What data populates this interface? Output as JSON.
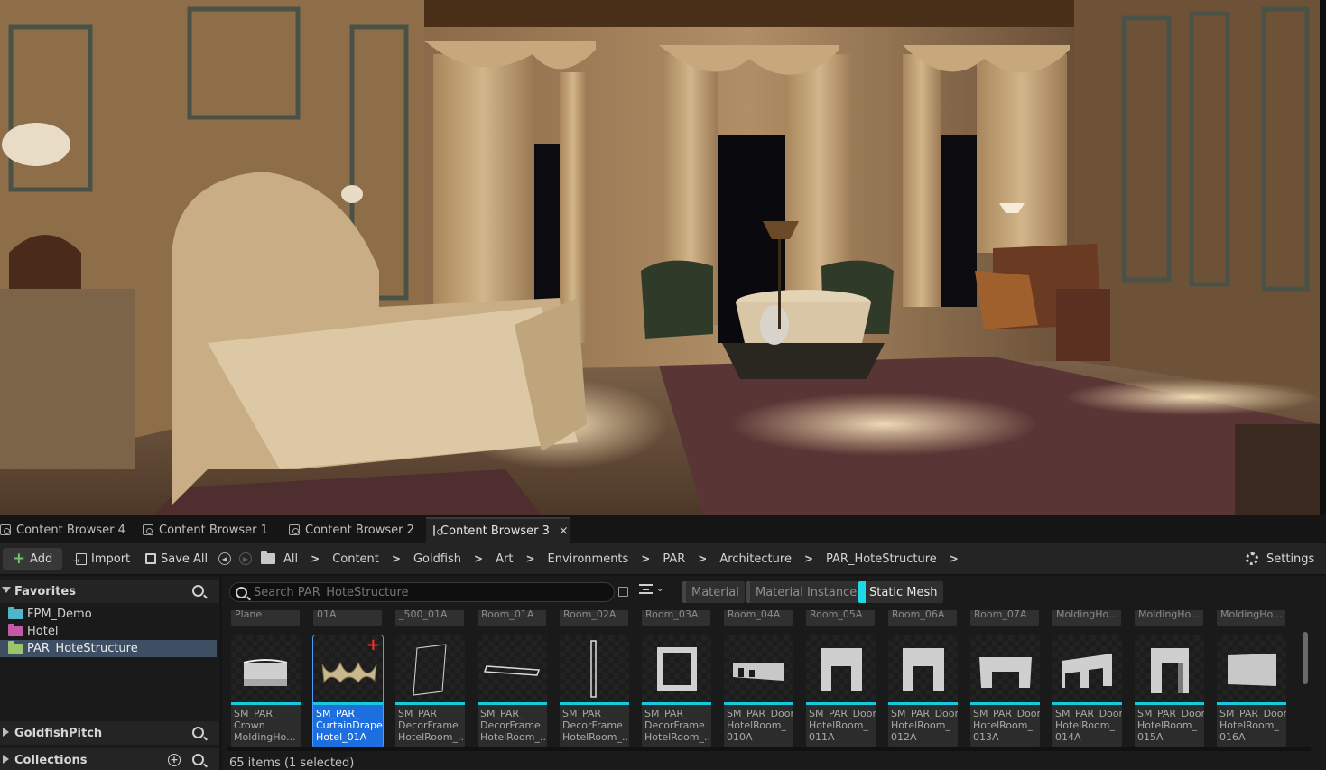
{
  "tabs": [
    {
      "label": "Content Browser 4",
      "active": false
    },
    {
      "label": "Content Browser 1",
      "active": false
    },
    {
      "label": "Content Browser 2",
      "active": false
    },
    {
      "label": "Content Browser 3",
      "active": true
    }
  ],
  "tab_close_glyph": "×",
  "toolbar": {
    "add_label": "Add",
    "import_label": "Import",
    "save_all_label": "Save All",
    "settings_label": "Settings"
  },
  "breadcrumb": [
    "All",
    "Content",
    "Goldfish",
    "Art",
    "Environments",
    "PAR",
    "Architecture",
    "PAR_HoteStructure"
  ],
  "favorites": {
    "header": "Favorites",
    "items": [
      {
        "label": "FPM_Demo",
        "color": "#4fb5c9"
      },
      {
        "label": "Hotel",
        "color": "#c25aa8"
      },
      {
        "label": "PAR_HoteStructure",
        "color": "#9cc46a",
        "selected": true
      }
    ]
  },
  "goldfishpitch_header": "GoldfishPitch",
  "collections_header": "Collections",
  "search": {
    "placeholder": "Search PAR_HoteStructure"
  },
  "filters": [
    {
      "label": "Material",
      "active": false
    },
    {
      "label": "Material Instance",
      "active": false
    },
    {
      "label": "Static Mesh",
      "active": true
    }
  ],
  "top_row_labels": [
    "Plane",
    "01A",
    "_500_01A",
    "Room_01A",
    "Room_02A",
    "Room_03A",
    "Room_04A",
    "Room_05A",
    "Room_06A",
    "Room_07A",
    "MoldingHo...",
    "MoldingHo...",
    "MoldingHo..."
  ],
  "assets": [
    {
      "label": "SM_PAR_\nCrown\nMoldingHo...",
      "shape": "crown"
    },
    {
      "label": "SM_PAR_\nCurtainDrape\nHotel_01A",
      "shape": "curtain",
      "selected": true
    },
    {
      "label": "SM_PAR_\nDecorFrame\nHotelRoom_...",
      "shape": "frame-thin"
    },
    {
      "label": "SM_PAR_\nDecorFrame\nHotelRoom_...",
      "shape": "frame-flat"
    },
    {
      "label": "SM_PAR_\nDecorFrame\nHotelRoom_...",
      "shape": "frame-tall"
    },
    {
      "label": "SM_PAR_\nDecorFrame\nHotelRoom_...",
      "shape": "frame-square"
    },
    {
      "label": "SM_PAR_Door\nHotelRoom_\n010A",
      "shape": "door-010"
    },
    {
      "label": "SM_PAR_Door\nHotelRoom_\n011A",
      "shape": "door-arch"
    },
    {
      "label": "SM_PAR_Door\nHotelRoom_\n012A",
      "shape": "door-arch"
    },
    {
      "label": "SM_PAR_Door\nHotelRoom_\n013A",
      "shape": "door-wide"
    },
    {
      "label": "SM_PAR_Door\nHotelRoom_\n014A",
      "shape": "door-corner"
    },
    {
      "label": "SM_PAR_Door\nHotelRoom_\n015A",
      "shape": "door-side"
    },
    {
      "label": "SM_PAR_Door\nHotelRoom_\n016A",
      "shape": "door-plain"
    }
  ],
  "status": "65 items (1 selected)",
  "colors": {
    "accent_cyan": "#18c9dd",
    "selection_blue": "#1d6fe0",
    "add_green": "#6ec36e"
  }
}
